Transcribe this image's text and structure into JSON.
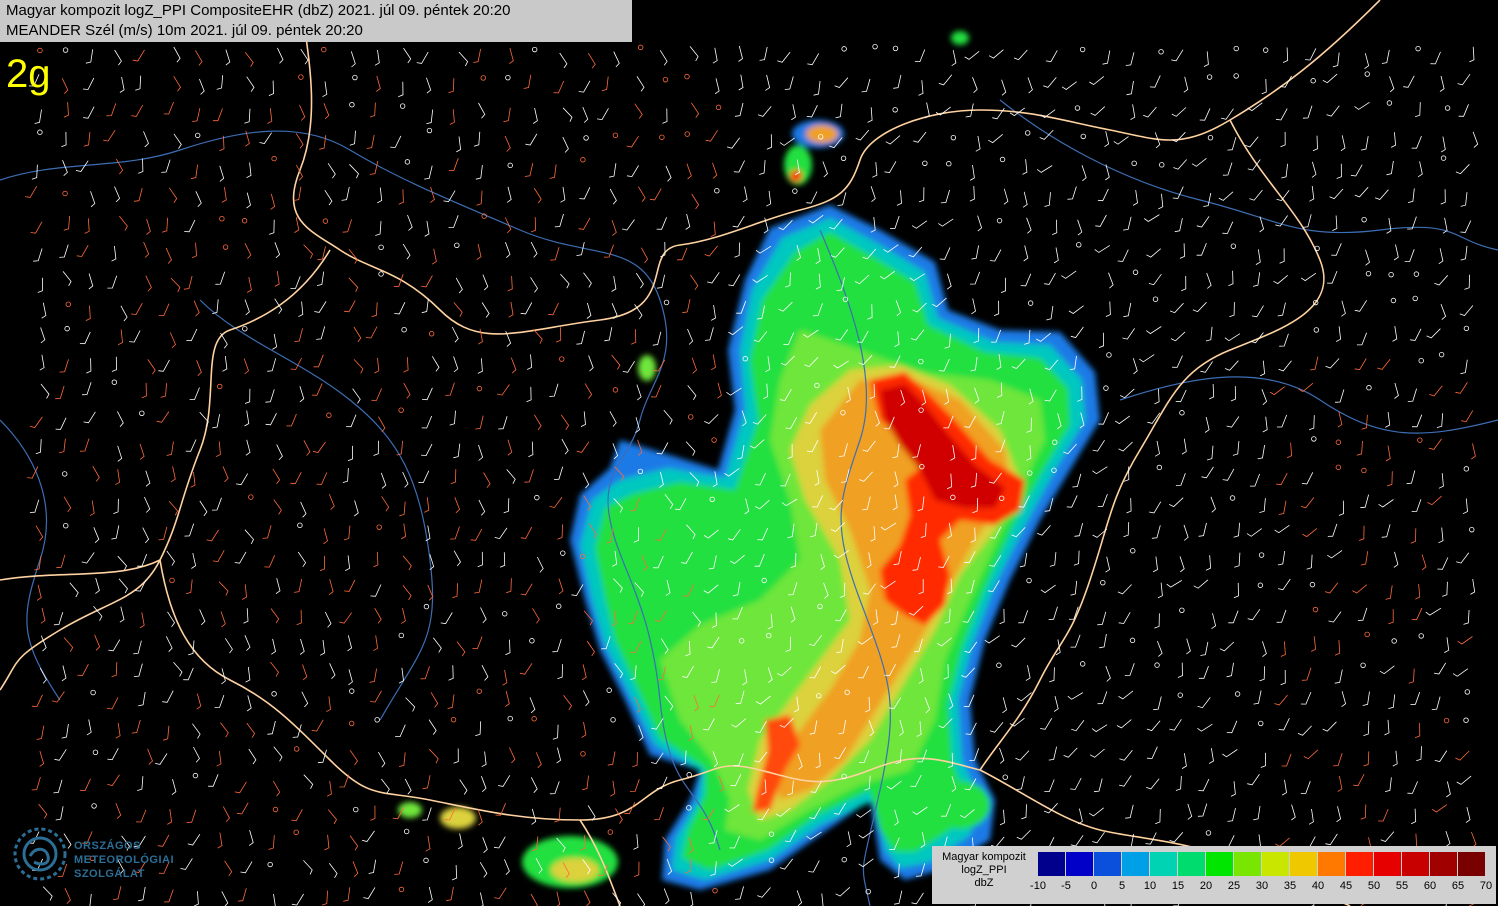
{
  "header": {
    "line1": "Magyar kompozit logZ_PPI CompositeEHR (dbZ) 2021. júl 09. péntek 20:20",
    "line2": "MEANDER Szél (m/s) 10m 2021. júl 09. péntek 20:20"
  },
  "panel_label": "2g",
  "logo": {
    "lines": [
      "ORSZÁGOS",
      "METEOROLÓGIAI",
      "SZOLGÁLAT"
    ],
    "icon": "omsz-logo-icon"
  },
  "legend": {
    "title_lines": [
      "Magyar kompozit",
      "logZ_PPI",
      "dbZ"
    ],
    "ticks": [
      "-10",
      "-5",
      "0",
      "5",
      "10",
      "15",
      "20",
      "25",
      "30",
      "35",
      "40",
      "45",
      "50",
      "55",
      "60",
      "65",
      "70"
    ],
    "colors": [
      "#00008c",
      "#0000c8",
      "#0a50dc",
      "#00a0e6",
      "#00d2b4",
      "#00dc6e",
      "#00e600",
      "#78e600",
      "#c8e600",
      "#f0c800",
      "#ff7800",
      "#ff1e00",
      "#e60000",
      "#c80000",
      "#a00000",
      "#780000"
    ]
  },
  "map_colors": {
    "background": "#000000",
    "border": "#ffd2a0",
    "river": "#3c6eb4",
    "wind_white": "#ffffff",
    "wind_orange": "#ff6a3c"
  }
}
